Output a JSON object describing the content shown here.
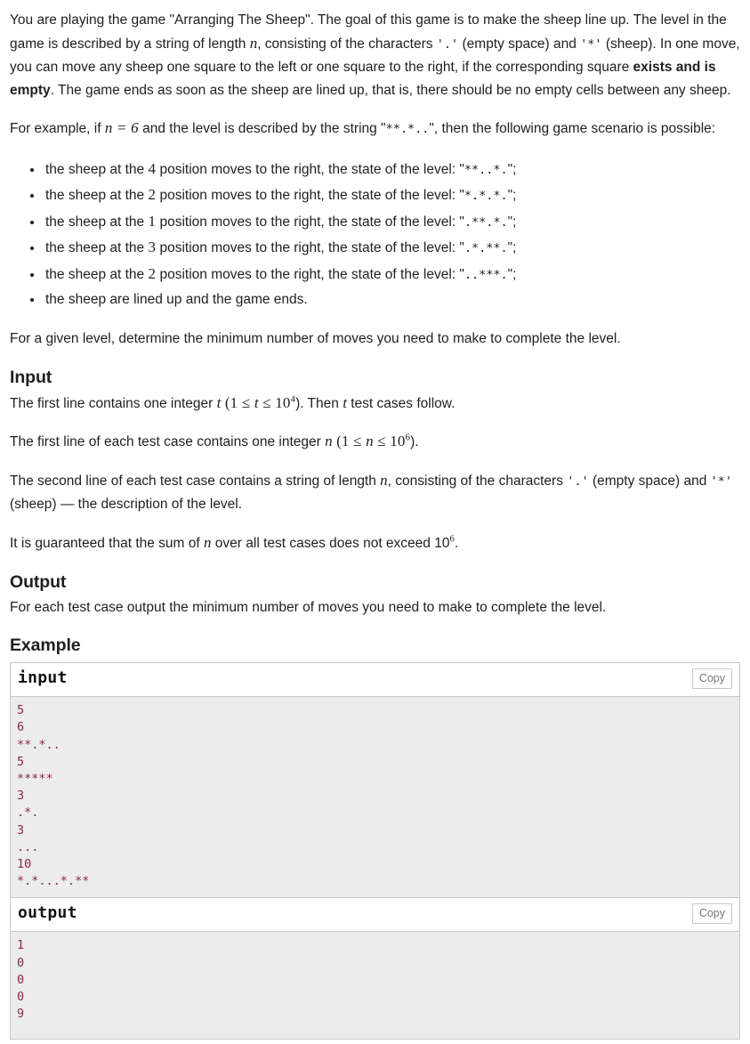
{
  "problem": {
    "intro": {
      "s1": "You are playing the game \"Arranging The Sheep\". The goal of this game is to make the sheep line up. The level in the game is described by a string of length ",
      "var_n": "n",
      "s2": ", consisting of the characters ",
      "code_dot": "'.'",
      "s3": " (empty space) and ",
      "code_star": "'*'",
      "s4": " (sheep). In one move, you can move any sheep one square to the left or one square to the right, if the corresponding square ",
      "bold": "exists and is empty",
      "s5": ". The game ends as soon as the sheep are lined up, that is, there should be no empty cells between any sheep."
    },
    "example_intro": {
      "s1": "For example, if ",
      "math": "n = 6",
      "s2": " and the level is described by the string \"",
      "level": "**.*..",
      "s3": "\", then the following game scenario is possible:"
    },
    "scenario": [
      {
        "s1": "the sheep at the ",
        "pos": "4",
        "s2": " position moves to the right, the state of the level: \"",
        "state": "**..*.",
        "s3": "\";"
      },
      {
        "s1": "the sheep at the ",
        "pos": "2",
        "s2": " position moves to the right, the state of the level: \"",
        "state": "*.*.*.",
        "s3": "\";"
      },
      {
        "s1": "the sheep at the ",
        "pos": "1",
        "s2": " position moves to the right, the state of the level: \"",
        "state": ".**.*.",
        "s3": "\";"
      },
      {
        "s1": "the sheep at the ",
        "pos": "3",
        "s2": " position moves to the right, the state of the level: \"",
        "state": ".*.**.",
        "s3": "\";"
      },
      {
        "s1": "the sheep at the ",
        "pos": "2",
        "s2": " position moves to the right, the state of the level: \"",
        "state": "..***.",
        "s3": "\";"
      }
    ],
    "scenario_last": "the sheep are lined up and the game ends.",
    "goal": "For a given level, determine the minimum number of moves you need to make to complete the level."
  },
  "input_section": {
    "heading": "Input",
    "p1": {
      "s1": "The first line contains one integer ",
      "var": "t",
      "s2": " (1 ≤ ",
      "var2": "t",
      "s3": " ≤ 10",
      "exp": "4",
      "s4": "). Then ",
      "var3": "t",
      "s5": " test cases follow."
    },
    "p2": {
      "s1": "The first line of each test case contains one integer ",
      "var": "n",
      "s2": " (1 ≤ ",
      "var2": "n",
      "s3": " ≤ 10",
      "exp": "6",
      "s4": ")."
    },
    "p3": {
      "s1": "The second line of each test case contains a string of length ",
      "var": "n",
      "s2": ", consisting of the characters ",
      "code_dot": "'.'",
      "s3": " (empty space) and ",
      "code_star": "'*'",
      "s4": " (sheep) — the description of the level."
    },
    "p4": {
      "s1": "It is guaranteed that the sum of ",
      "var": "n",
      "s2": " over all test cases does not exceed 10",
      "exp": "6",
      "s3": "."
    }
  },
  "output_section": {
    "heading": "Output",
    "p1": "For each test case output the minimum number of moves you need to make to complete the level."
  },
  "example_section": {
    "heading": "Example",
    "input_label": "input",
    "output_label": "output",
    "copy_label": "Copy",
    "input_data": "5\n6\n**.*..\n5\n*****\n3\n.*.\n3\n...\n10\n*.*...*.**",
    "output_data": "1\n0\n0\n0\n9"
  },
  "colors": {
    "code_text": "#8a2846",
    "code_bg": "#ececec",
    "border": "#c8c8c8",
    "copy_text": "#777777"
  }
}
